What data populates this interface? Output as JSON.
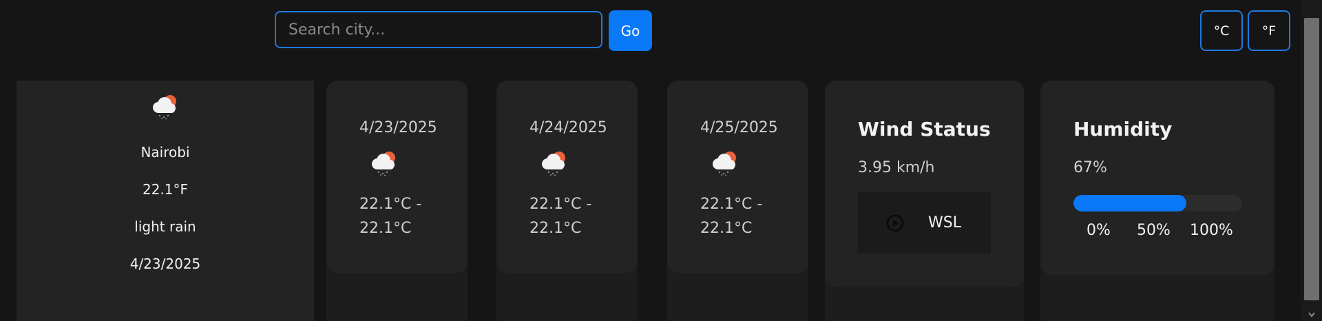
{
  "search": {
    "placeholder": "Search city...",
    "button": "Go"
  },
  "units": {
    "celsius": "°C",
    "fahrenheit": "°F"
  },
  "current": {
    "icon": "cloud-rain-sun-icon",
    "city": "Nairobi",
    "temp": "22.1°F",
    "description": "light rain",
    "date": "4/23/2025"
  },
  "forecast": [
    {
      "date": "4/23/2025",
      "icon": "cloud-rain-sun-icon",
      "range_line1": "22.1°C -",
      "range_line2": "22.1°C"
    },
    {
      "date": "4/24/2025",
      "icon": "cloud-rain-sun-icon",
      "range_line1": "22.1°C -",
      "range_line2": "22.1°C"
    },
    {
      "date": "4/25/2025",
      "icon": "cloud-rain-sun-icon",
      "range_line1": "22.1°C -",
      "range_line2": "22.1°C"
    }
  ],
  "wind": {
    "title": "Wind Status",
    "speed": "3.95 km/h",
    "label": "WSL"
  },
  "humidity": {
    "title": "Humidity",
    "value": "67%",
    "fraction": 0.67,
    "ticks": [
      "0%",
      "50%",
      "100%"
    ]
  },
  "colors": {
    "accent": "#0a79f7",
    "card": "#232323",
    "background": "#151515",
    "sun": "#e8623b"
  }
}
